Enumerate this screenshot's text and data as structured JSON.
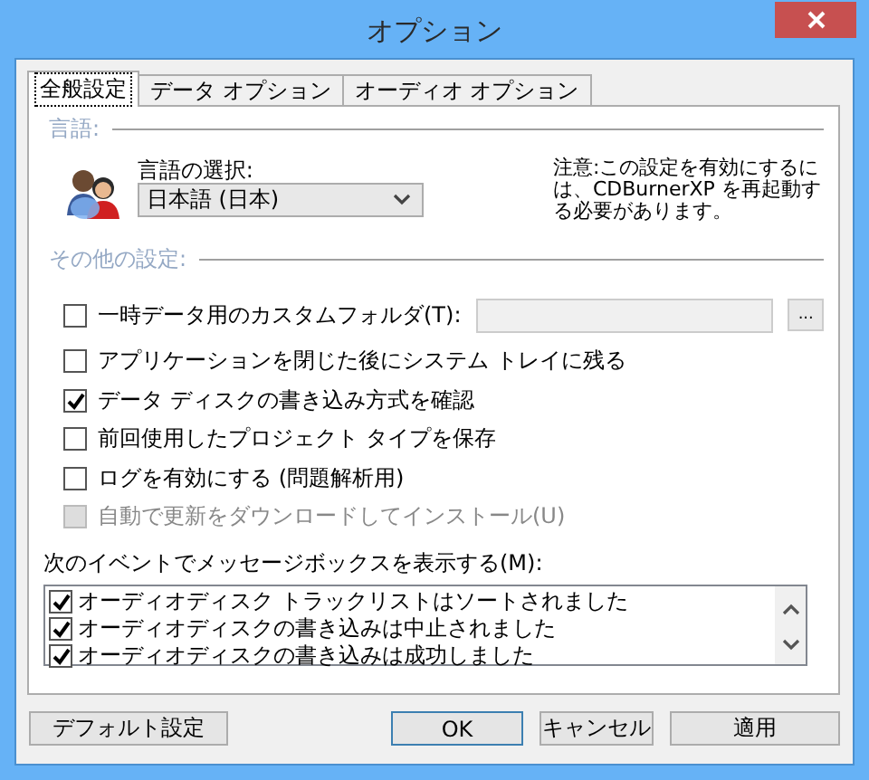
{
  "window": {
    "title": "オプション"
  },
  "tabs": [
    {
      "label": "全般設定",
      "selected": true
    },
    {
      "label": "データ オプション",
      "selected": false
    },
    {
      "label": "オーディオ オプション",
      "selected": false
    }
  ],
  "language": {
    "heading": "言語:",
    "label": "言語の選択:",
    "value": "日本語 (日本)",
    "note": "注意:この設定を有効にするには、CDBurnerXP を再起動する必要があります。"
  },
  "other": {
    "heading": "その他の設定:",
    "browse_button": "...",
    "options": [
      {
        "kind": "folder",
        "label": "一時データ用のカスタムフォルダ(T):",
        "checked": false,
        "disabled": false
      },
      {
        "kind": "plain",
        "label": "アプリケーションを閉じた後にシステム トレイに残る",
        "checked": false,
        "disabled": false
      },
      {
        "kind": "plain",
        "label": "データ ディスクの書き込み方式を確認",
        "checked": true,
        "disabled": false
      },
      {
        "kind": "plain",
        "label": "前回使用したプロジェクト タイプを保存",
        "checked": false,
        "disabled": false
      },
      {
        "kind": "plain",
        "label": "ログを有効にする (問題解析用)",
        "checked": false,
        "disabled": false
      },
      {
        "kind": "plain",
        "label": "自動で更新をダウンロードしてインストール(U)",
        "checked": false,
        "disabled": true
      }
    ]
  },
  "events": {
    "label": "次のイベントでメッセージボックスを表示する(M):",
    "items": [
      {
        "label": "オーディオディスク トラックリストはソートされました",
        "checked": true
      },
      {
        "label": "オーディオディスクの書き込みは中止されました",
        "checked": true
      },
      {
        "label": "オーディオディスクの書き込みは成功しました",
        "checked": true
      }
    ]
  },
  "buttons": [
    {
      "label": "デフォルト設定",
      "kind": "left",
      "default": false
    },
    {
      "label": "OK",
      "kind": "right",
      "default": true
    },
    {
      "label": "キャンセル",
      "kind": "right",
      "default": false
    },
    {
      "label": "適用",
      "kind": "right",
      "default": false
    }
  ]
}
